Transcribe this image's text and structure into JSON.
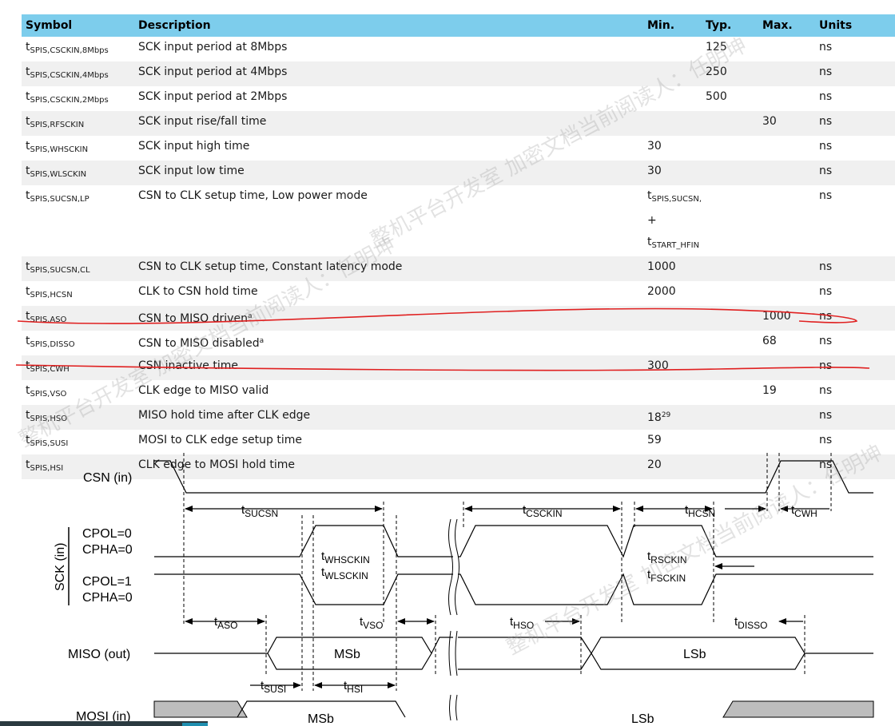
{
  "table": {
    "headers": {
      "symbol": "Symbol",
      "description": "Description",
      "min": "Min.",
      "typ": "Typ.",
      "max": "Max.",
      "units": "Units"
    },
    "rows": [
      {
        "sym": "t",
        "sub": "SPIS,CSCKIN,8Mbps",
        "desc": "SCK input period at 8Mbps",
        "min": "",
        "typ": "125",
        "max": "",
        "units": "ns"
      },
      {
        "sym": "t",
        "sub": "SPIS,CSCKIN,4Mbps",
        "desc": "SCK input period at 4Mbps",
        "min": "",
        "typ": "250",
        "max": "",
        "units": "ns"
      },
      {
        "sym": "t",
        "sub": "SPIS,CSCKIN,2Mbps",
        "desc": "SCK input period at 2Mbps",
        "min": "",
        "typ": "500",
        "max": "",
        "units": "ns"
      },
      {
        "sym": "t",
        "sub": "SPIS,RFSCKIN",
        "desc": "SCK input rise/fall time",
        "min": "",
        "typ": "",
        "max": "30",
        "units": "ns"
      },
      {
        "sym": "t",
        "sub": "SPIS,WHSCKIN",
        "desc": "SCK input high time",
        "min": "30",
        "typ": "",
        "max": "",
        "units": "ns"
      },
      {
        "sym": "t",
        "sub": "SPIS,WLSCKIN",
        "desc": "SCK input low time",
        "min": "30",
        "typ": "",
        "max": "",
        "units": "ns"
      },
      {
        "sym": "t",
        "sub": "SPIS,SUCSN,LP",
        "desc": "CSN to CLK setup time, Low power mode",
        "min_line1": "t",
        "min_line1_sub": "SPIS,SUCSN,",
        "min_line2": "+",
        "min_line3": "t",
        "min_line3_sub": "START_HFIN",
        "typ": "",
        "max": "",
        "units": "ns"
      },
      {
        "sym": "t",
        "sub": "SPIS,SUCSN,CL",
        "desc": "CSN to CLK setup time, Constant latency mode",
        "min": "1000",
        "typ": "",
        "max": "",
        "units": "ns"
      },
      {
        "sym": "t",
        "sub": "SPIS,HCSN",
        "desc": "CLK to CSN hold time",
        "min": "2000",
        "typ": "",
        "max": "",
        "units": "ns"
      },
      {
        "sym": "t",
        "sub": "SPIS,ASO",
        "desc": "CSN to MISO driven",
        "desc_sup": "a",
        "min": "",
        "typ": "",
        "max": "1000",
        "units": "ns"
      },
      {
        "sym": "t",
        "sub": "SPIS,DISSO",
        "desc": "CSN to MISO disabled",
        "desc_sup": "a",
        "min": "",
        "typ": "",
        "max": "68",
        "units": "ns"
      },
      {
        "sym": "t",
        "sub": "SPIS,CWH",
        "desc": "CSN inactive time",
        "min": "300",
        "typ": "",
        "max": "",
        "units": "ns"
      },
      {
        "sym": "t",
        "sub": "SPIS,VSO",
        "desc": "CLK edge to MISO valid",
        "min": "",
        "typ": "",
        "max": "19",
        "units": "ns"
      },
      {
        "sym": "t",
        "sub": "SPIS,HSO",
        "desc": "MISO hold time after CLK edge",
        "min": "18",
        "min_sup": "29",
        "typ": "",
        "max": "",
        "units": "ns"
      },
      {
        "sym": "t",
        "sub": "SPIS,SUSI",
        "desc": "MOSI to CLK edge setup time",
        "min": "59",
        "typ": "",
        "max": "",
        "units": "ns"
      },
      {
        "sym": "t",
        "sub": "SPIS,HSI",
        "desc": "CLK edge to MOSI hold time",
        "min": "20",
        "typ": "",
        "max": "",
        "units": "ns"
      }
    ]
  },
  "timing": {
    "signals": {
      "csn": "CSN (in)",
      "sck": "SCK (in)",
      "cpol0": "CPOL=0",
      "cpha0": "CPHA=0",
      "cpol1": "CPOL=1",
      "cpha1": "CPHA=0",
      "miso": "MISO (out)",
      "mosi": "MOSI (in)"
    },
    "params": {
      "sucsn": "SUCSN",
      "csckin": "CSCKIN",
      "hcsn": "HCSN",
      "cwh": "CWH",
      "whsckin": "WHSCKIN",
      "wlsckin": "WLSCKIN",
      "rsckin": "RSCKIN",
      "fsckin": "FSCKIN",
      "aso": "ASO",
      "vso": "VSO",
      "hso": "HSO",
      "disso": "DISSO",
      "susi": "SUSI",
      "hsi": "HSI",
      "t": "t"
    },
    "data_labels": {
      "msb": "MSb",
      "lsb": "LSb"
    }
  },
  "watermark": "整机平台开发室 加密文档当前阅读人：任明坤",
  "colors": {
    "header": "#7dcdec",
    "annotation": "#e02020",
    "stripe": "#f0f0f0"
  }
}
